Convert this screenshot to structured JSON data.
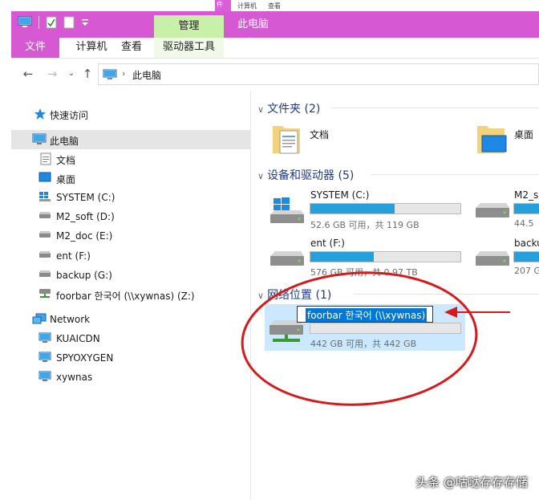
{
  "top_strip": {
    "tabs": [
      "件",
      "计算机",
      "查看"
    ]
  },
  "titlebar": {
    "manage_tab": "管理",
    "title": "此电脑"
  },
  "ribbon": {
    "file": "文件",
    "computer": "计算机",
    "view": "查看",
    "drive_tools": "驱动器工具"
  },
  "address": {
    "crumb": "此电脑"
  },
  "nav": {
    "quick_access": "快速访问",
    "this_pc": "此电脑",
    "documents": "文档",
    "desktop": "桌面",
    "system_c": "SYSTEM (C:)",
    "m2soft_d": "M2_soft (D:)",
    "m2doc_e": "M2_doc (E:)",
    "ent_f": "ent (F:)",
    "backup_g": "backup (G:)",
    "foorbar_z": "foorbar 한국어 (\\\\xywnas) (Z:)",
    "network": "Network",
    "kuaicdn": "KUAICDN",
    "spyoxygen": "SPYOXYGEN",
    "xywnas": "xywnas"
  },
  "content": {
    "folders_header": "文件夹 (2)",
    "folder_documents": "文档",
    "folder_desktop": "桌面",
    "devices_header": "设备和驱动器 (5)",
    "drive_system": {
      "name": "SYSTEM (C:)",
      "size": "52.6 GB 可用，共 119 GB",
      "used_fraction": 0.56
    },
    "drive_m2soft": {
      "name": "M2_s",
      "size": "44.5"
    },
    "drive_ent": {
      "name": "ent (F:)",
      "size": "576 GB 可用，共 0.97 TB",
      "used_fraction": 0.42
    },
    "drive_backup": {
      "name": "backu",
      "size": "207 G"
    },
    "network_header": "网络位置 (1)",
    "net_drive": {
      "name": "foorbar 한국어 (\\\\xywnas)",
      "size": "442 GB 可用，共 442 GB",
      "used_fraction": 0.0
    }
  },
  "colors": {
    "titlebar": "#d658d3",
    "manage_tab": "#c8f0a8",
    "accent": "#26a0da",
    "selection": "#0078d7",
    "annotation": "#d7191c"
  },
  "watermark": "头条 @咕哒存存存储"
}
